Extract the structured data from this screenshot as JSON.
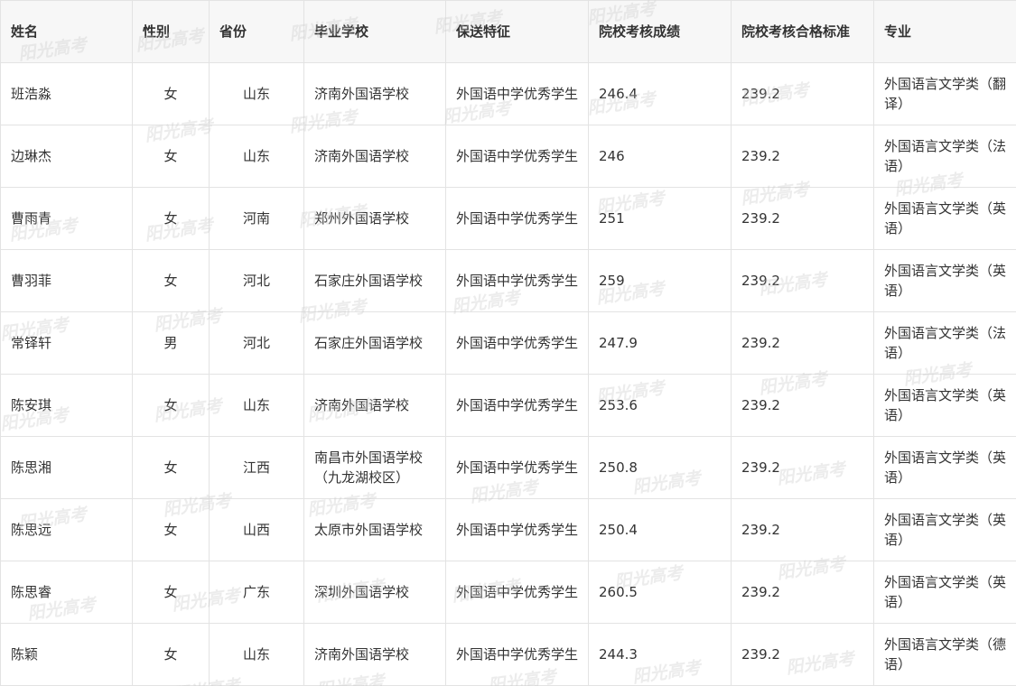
{
  "table": {
    "headers": [
      "姓名",
      "性别",
      "省份",
      "毕业学校",
      "保送特征",
      "院校考核成绩",
      "院校考核合格标准",
      "专业"
    ],
    "rows": [
      [
        "班浩淼",
        "女",
        "山东",
        "济南外国语学校",
        "外国语中学优秀学生",
        "246.4",
        "239.2",
        "外国语言文学类（翻译）"
      ],
      [
        "边琳杰",
        "女",
        "山东",
        "济南外国语学校",
        "外国语中学优秀学生",
        "246",
        "239.2",
        "外国语言文学类（法语）"
      ],
      [
        "曹雨青",
        "女",
        "河南",
        "郑州外国语学校",
        "外国语中学优秀学生",
        "251",
        "239.2",
        "外国语言文学类（英语）"
      ],
      [
        "曹羽菲",
        "女",
        "河北",
        "石家庄外国语学校",
        "外国语中学优秀学生",
        "259",
        "239.2",
        "外国语言文学类（英语）"
      ],
      [
        "常铎轩",
        "男",
        "河北",
        "石家庄外国语学校",
        "外国语中学优秀学生",
        "247.9",
        "239.2",
        "外国语言文学类（法语）"
      ],
      [
        "陈安琪",
        "女",
        "山东",
        "济南外国语学校",
        "外国语中学优秀学生",
        "253.6",
        "239.2",
        "外国语言文学类（英语）"
      ],
      [
        "陈思湘",
        "女",
        "江西",
        "南昌市外国语学校（九龙湖校区）",
        "外国语中学优秀学生",
        "250.8",
        "239.2",
        "外国语言文学类（英语）"
      ],
      [
        "陈思远",
        "女",
        "山西",
        "太原市外国语学校",
        "外国语中学优秀学生",
        "250.4",
        "239.2",
        "外国语言文学类（英语）"
      ],
      [
        "陈思睿",
        "女",
        "广东",
        "深圳外国语学校",
        "外国语中学优秀学生",
        "260.5",
        "239.2",
        "外国语言文学类（英语）"
      ],
      [
        "陈颖",
        "女",
        "山东",
        "济南外国语学校",
        "外国语中学优秀学生",
        "244.3",
        "239.2",
        "外国语言文学类（德语）"
      ]
    ]
  },
  "watermark": "阳光高考"
}
